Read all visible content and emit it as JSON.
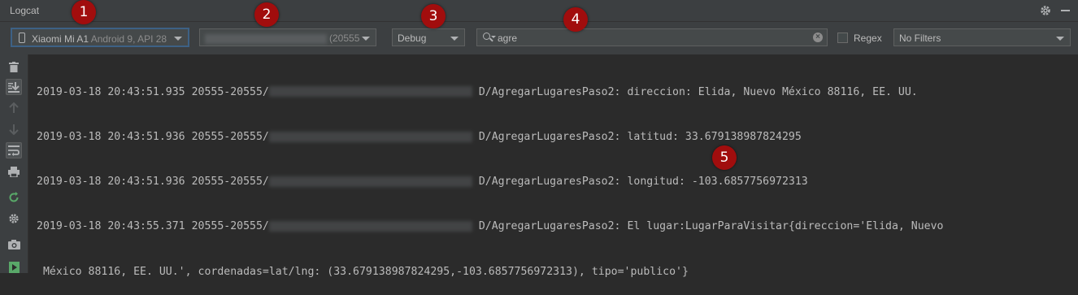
{
  "window": {
    "title": "Logcat"
  },
  "toolbar": {
    "device": {
      "name": "Xiaomi Mi A1",
      "detail": "Android 9, API 28"
    },
    "process": {
      "pid": "(20555"
    },
    "log_level": "Debug",
    "search": {
      "value": "agre"
    },
    "regex_label": "Regex",
    "filter": "No Filters"
  },
  "log": {
    "lines": [
      {
        "timestamp": "2019-03-18 20:43:51.935",
        "pid": "20555-20555/",
        "tag": "D/AgregarLugaresPaso2:",
        "message": "direccion: Elida, Nuevo México 88116, EE. UU."
      },
      {
        "timestamp": "2019-03-18 20:43:51.936",
        "pid": "20555-20555/",
        "tag": "D/AgregarLugaresPaso2:",
        "message": "latitud: 33.679138987824295"
      },
      {
        "timestamp": "2019-03-18 20:43:51.936",
        "pid": "20555-20555/",
        "tag": "D/AgregarLugaresPaso2:",
        "message": "longitud: -103.6857756972313"
      },
      {
        "timestamp": "2019-03-18 20:43:55.371",
        "pid": "20555-20555/",
        "tag": "D/AgregarLugaresPaso2:",
        "message": "El lugar:LugarParaVisitar{direccion='Elida, Nuevo"
      }
    ],
    "continuation": "México 88116, EE. UU.', cordenadas=lat/lng: (33.679138987824295,-103.6857756972313), tipo='publico'}"
  },
  "annotations": {
    "b1": "1",
    "b2": "2",
    "b3": "3",
    "b4": "4",
    "b5": "5"
  },
  "colors": {
    "background": "#2b2b2b",
    "panel": "#3c3f41",
    "badge": "#a10d0d",
    "focus": "#3d6185"
  }
}
